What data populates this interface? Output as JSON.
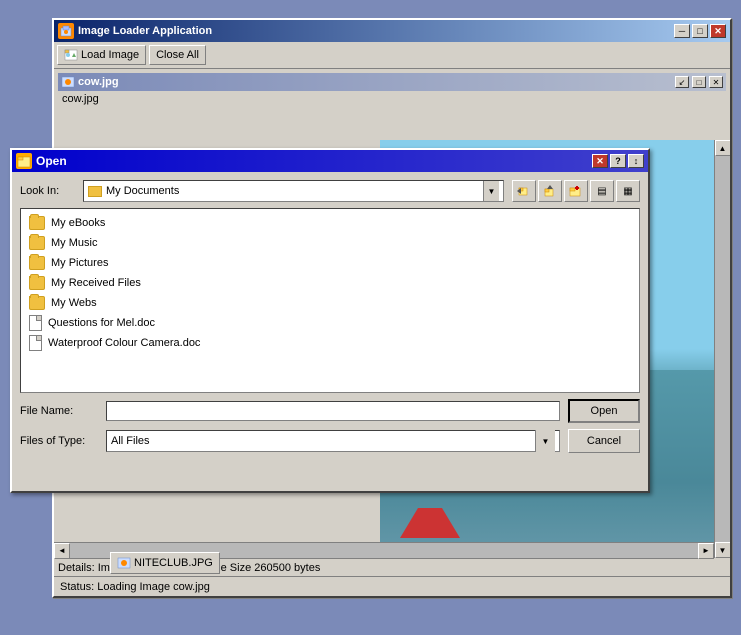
{
  "app": {
    "title": "Image Loader Application",
    "toolbar": {
      "load_image": "Load Image",
      "close_all": "Close All"
    },
    "mdi_child": {
      "title": "cow.jpg",
      "label": "cow.jpg"
    },
    "status": {
      "detail": "Details: Image Size(1263,692) File Size 260500 bytes",
      "main": "Status: Loading Image cow.jpg"
    },
    "taskbar_item": "NITECLUB.JPG"
  },
  "dialog": {
    "title": "Open",
    "look_in_label": "Look In:",
    "look_in_value": "My Documents",
    "files": [
      {
        "name": "My eBooks",
        "type": "folder"
      },
      {
        "name": "My Music",
        "type": "folder"
      },
      {
        "name": "My Pictures",
        "type": "folder"
      },
      {
        "name": "My Received Files",
        "type": "folder"
      },
      {
        "name": "My Webs",
        "type": "folder"
      },
      {
        "name": "Questions for Mel.doc",
        "type": "doc"
      },
      {
        "name": "Waterproof Colour Camera.doc",
        "type": "doc"
      }
    ],
    "file_name_label": "File Name:",
    "file_name_value": "",
    "files_of_type_label": "Files of Type:",
    "files_of_type_value": "All Files",
    "open_btn": "Open",
    "cancel_btn": "Cancel"
  },
  "icons": {
    "minimize": "─",
    "maximize": "□",
    "restore_up": "↑",
    "restore": "↕",
    "close": "✕",
    "arrow_down": "▼",
    "arrow_up": "▲",
    "arrow_left": "◄",
    "arrow_right": "►",
    "folder": "📁",
    "back": "←",
    "home": "⌂",
    "newdir": "✦",
    "listview": "▤",
    "detailview": "▦"
  }
}
